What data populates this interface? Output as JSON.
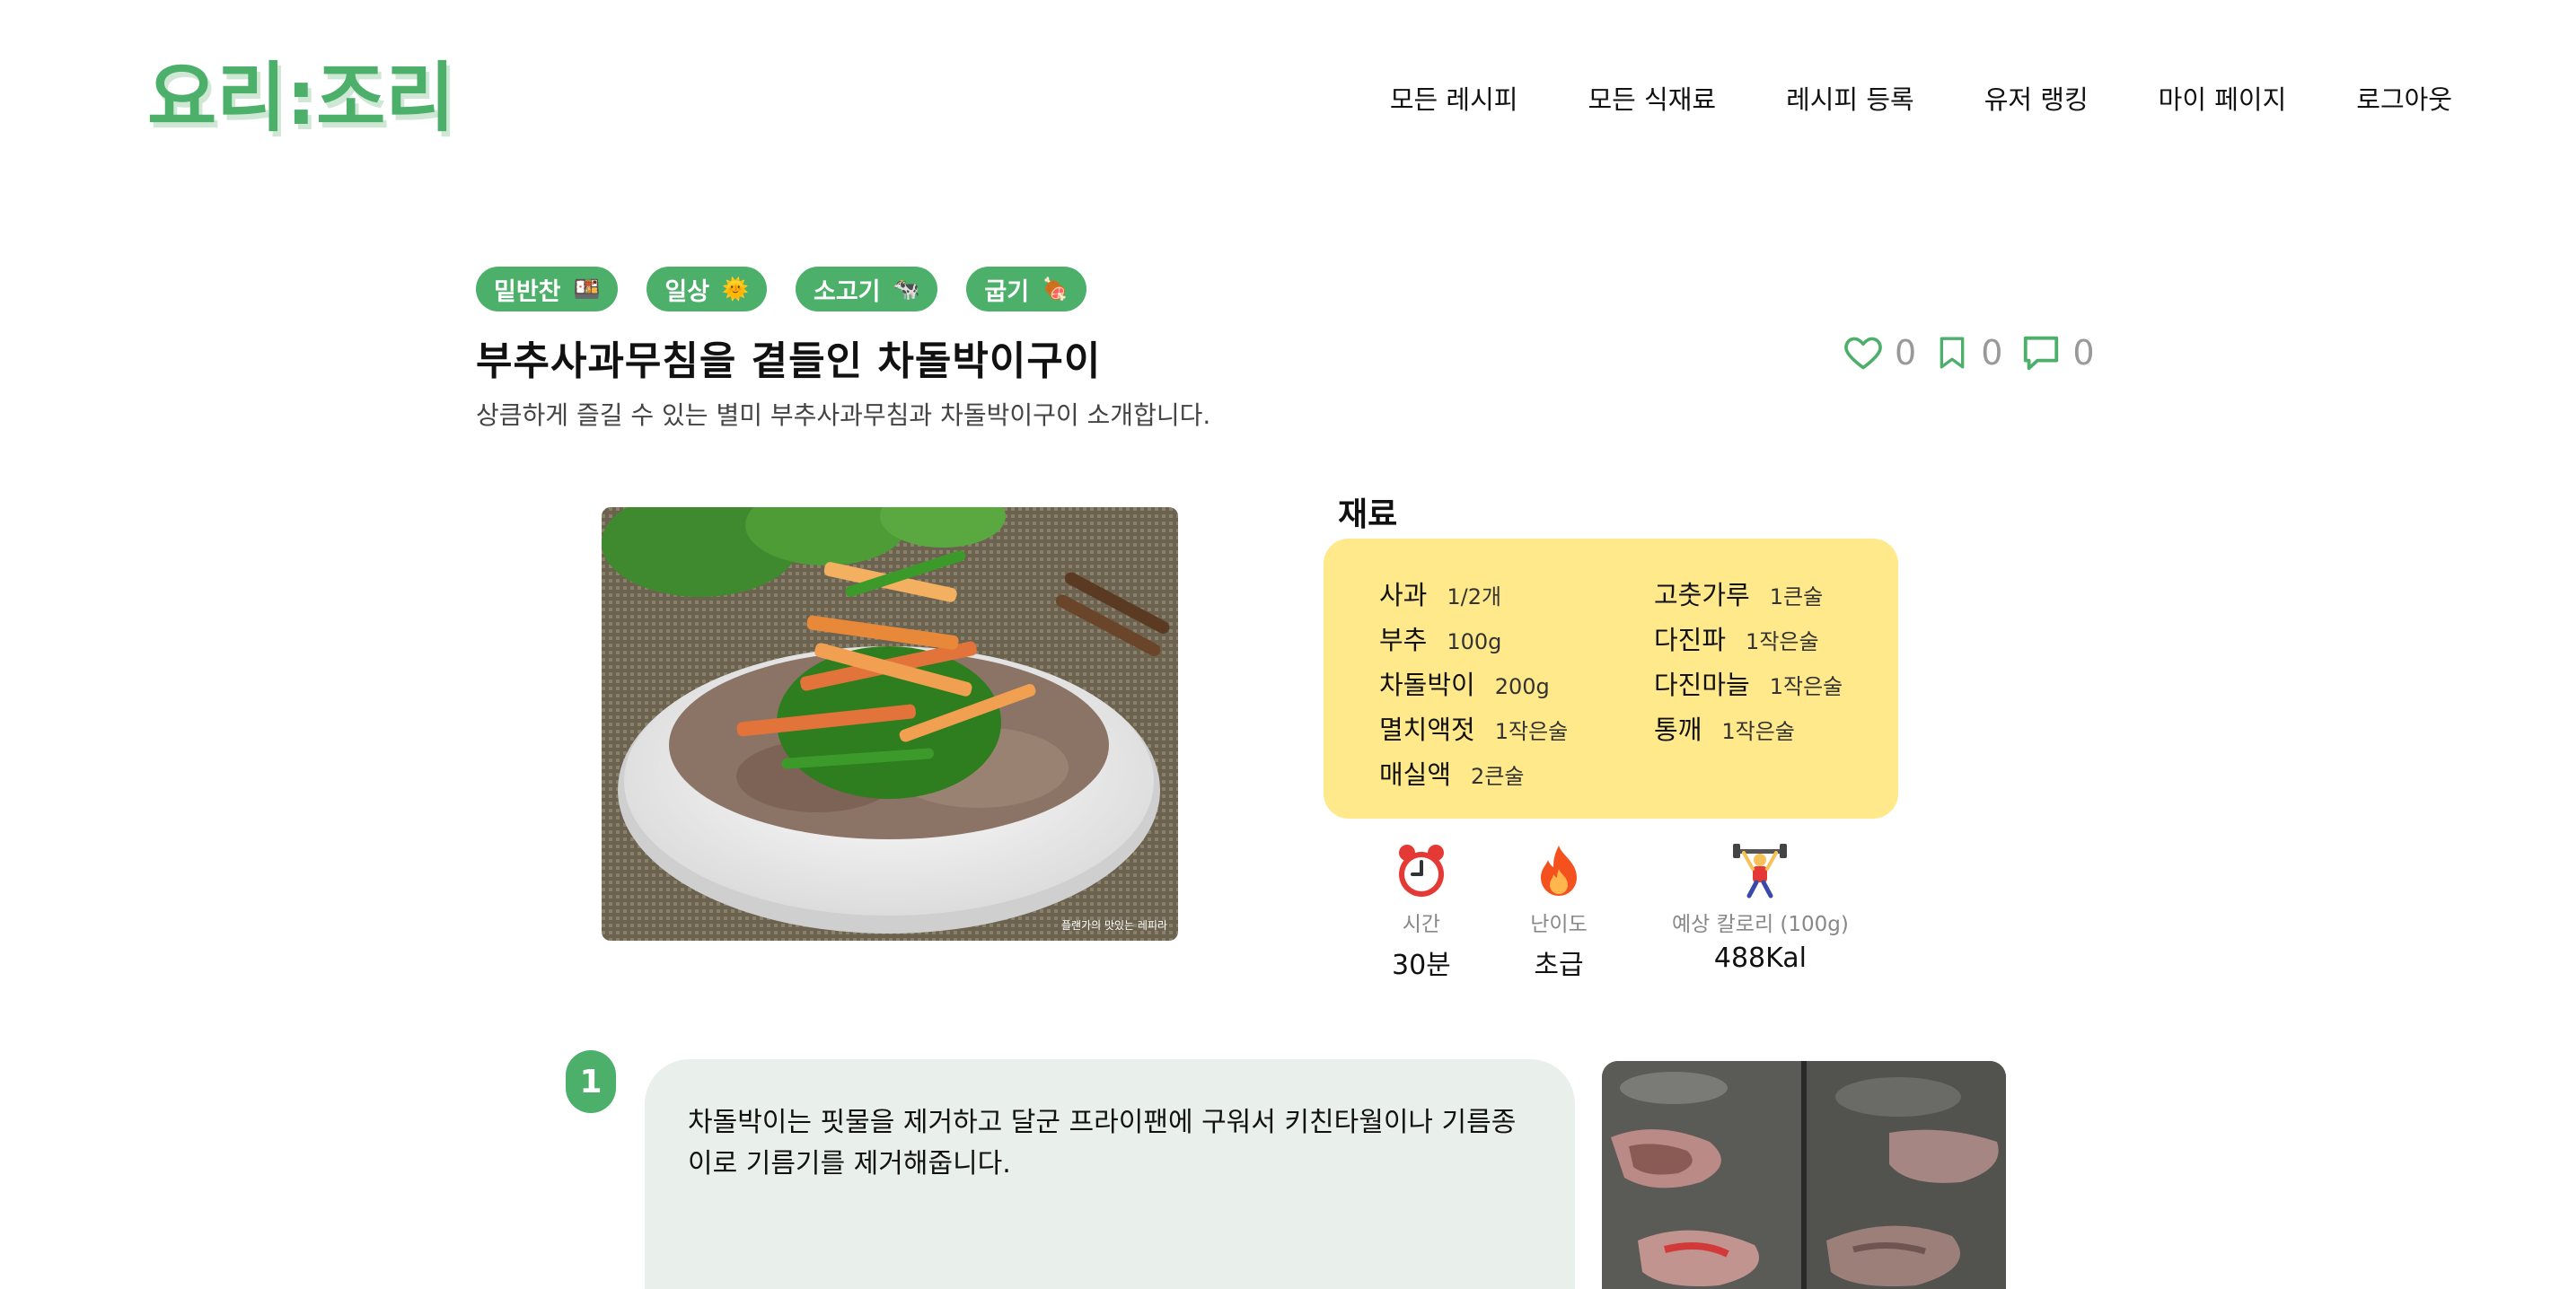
{
  "brand": {
    "logo_text": "요리:조리",
    "color": "#4caf6a"
  },
  "nav": [
    {
      "label": "모든 레시피"
    },
    {
      "label": "모든 식재료"
    },
    {
      "label": "레시피 등록"
    },
    {
      "label": "유저 랭킹"
    },
    {
      "label": "마이 페이지"
    },
    {
      "label": "로그아웃"
    }
  ],
  "tags": [
    {
      "label": "밑반찬",
      "icon": "🍱"
    },
    {
      "label": "일상",
      "icon": "🌞"
    },
    {
      "label": "소고기",
      "icon": "🐄"
    },
    {
      "label": "굽기",
      "icon": "🍖"
    }
  ],
  "recipe": {
    "title": "부추사과무침을 곁들인 차돌박이구이",
    "description": "상큼하게 즐길 수 있는 별미 부추사과무침과 차돌박이구이 소개합니다.",
    "image_caption": "플랜가의 맛있는 레피라"
  },
  "stats": {
    "likes": "0",
    "bookmarks": "0",
    "comments": "0"
  },
  "ingredients": {
    "title": "재료",
    "items": [
      {
        "name": "사과",
        "amount": "1/2개"
      },
      {
        "name": "고춧가루",
        "amount": "1큰술"
      },
      {
        "name": "부추",
        "amount": "100g"
      },
      {
        "name": "다진파",
        "amount": "1작은술"
      },
      {
        "name": "차돌박이",
        "amount": "200g"
      },
      {
        "name": "다진마늘",
        "amount": "1작은술"
      },
      {
        "name": "멸치액젓",
        "amount": "1작은술"
      },
      {
        "name": "통깨",
        "amount": "1작은술"
      },
      {
        "name": "매실액",
        "amount": "2큰술"
      }
    ]
  },
  "info": {
    "time": {
      "label": "시간",
      "value": "30분",
      "icon": "alarm-clock"
    },
    "difficulty": {
      "label": "난이도",
      "value": "초급",
      "icon": "fire"
    },
    "calories": {
      "label": "예상 칼로리 (100g)",
      "value": "488Kal",
      "icon": "weightlifter"
    }
  },
  "steps": [
    {
      "number": "1",
      "text": "차돌박이는 핏물을 제거하고 달군 프라이팬에 구워서 키친타월이나 기름종이로 기름기를 제거해줍니다."
    }
  ]
}
